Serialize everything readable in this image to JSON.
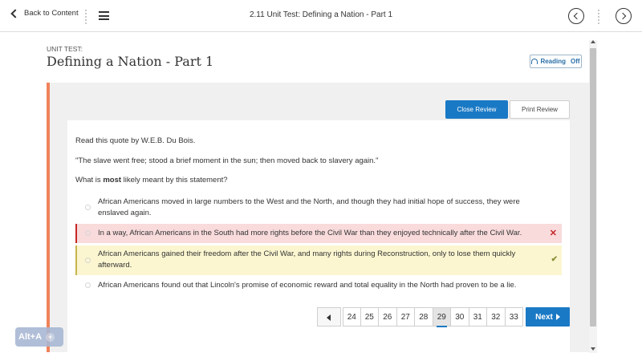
{
  "topbar": {
    "back_label": "Back to Content",
    "title": "2.11 Unit Test: Defining a Nation - Part 1"
  },
  "header": {
    "unit_label": "UNIT TEST:",
    "title": "Defining a Nation - Part 1",
    "reading_label": "Reading",
    "reading_state": "Off"
  },
  "review": {
    "close_label": "Close Review",
    "print_label": "Print Review"
  },
  "question": {
    "prompt": "Read this quote by W.E.B. Du Bois.",
    "quote": "\"The slave went free; stood a brief moment in the sun; then moved back to slavery again.\"",
    "instr_before": "What is ",
    "instr_bold": "most",
    "instr_after": " likely meant by this statement?",
    "options": [
      {
        "text": "African Americans moved in large numbers to the West and the North, and though they had initial hope of success, they were enslaved again.",
        "state": "none"
      },
      {
        "text": "In a way, African Americans in the South had more rights before the Civil War than they enjoyed technically after the Civil War.",
        "state": "wrong",
        "mark": "✕"
      },
      {
        "text": "African Americans gained their freedom after the Civil War, and many rights during Reconstruction, only to lose them quickly afterward.",
        "state": "correct",
        "mark": "✔"
      },
      {
        "text": "African Americans found out that Lincoln's promise of economic reward and total equality in the North had proven to be a lie.",
        "state": "none"
      }
    ]
  },
  "pagination": {
    "pages": [
      "24",
      "25",
      "26",
      "27",
      "28",
      "29",
      "30",
      "31",
      "32",
      "33"
    ],
    "current": "29",
    "next_label": "Next"
  },
  "accessibility": {
    "badge_label": "Alt+A",
    "badge_plus": "+"
  },
  "colors": {
    "accent": "#1a79c5",
    "orange": "#f0825a",
    "wrong_bg": "#f9dbdc",
    "correct_bg": "#fbf6d0"
  }
}
